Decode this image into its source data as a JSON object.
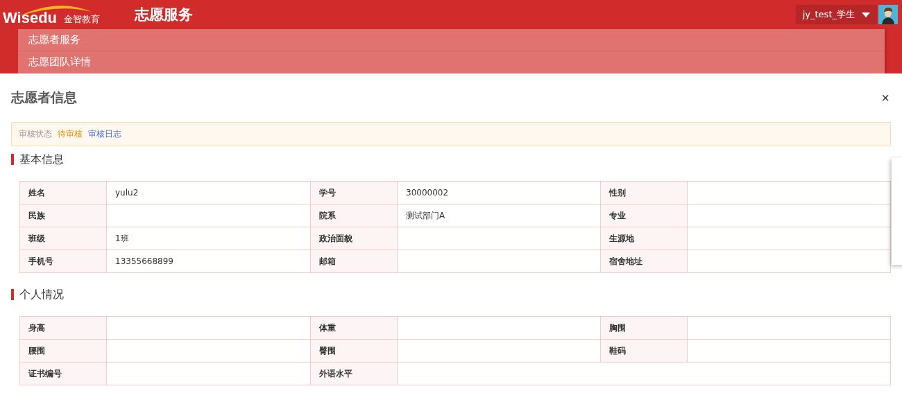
{
  "header": {
    "logo_text": "Wisedu",
    "logo_subtext": "金智教育",
    "app_title": "志愿服务",
    "user": "jy_test_学生"
  },
  "menu": [
    {
      "label": "志愿者服务"
    },
    {
      "label": "志愿团队详情"
    }
  ],
  "dialog": {
    "title": "志愿者信息",
    "close": "×",
    "status": {
      "label": "审核状态",
      "value": "待审核",
      "log_link": "审核日志"
    },
    "sections": [
      {
        "title": "基本信息",
        "rows": [
          [
            {
              "label": "姓名",
              "value": "yulu2"
            },
            {
              "label": "学号",
              "value": "30000002"
            },
            {
              "label": "性别"
            }
          ],
          [
            {
              "label": "民族"
            },
            {
              "label": "院系",
              "value": "测试部门A"
            },
            {
              "label": "专业"
            }
          ],
          [
            {
              "label": "班级",
              "value": "1班"
            },
            {
              "label": "政治面貌"
            },
            {
              "label": "生源地"
            }
          ],
          [
            {
              "label": "手机号",
              "value": "13355668899"
            },
            {
              "label": "邮箱"
            },
            {
              "label": "宿舍地址"
            }
          ]
        ]
      },
      {
        "title": "个人情况",
        "rows": [
          [
            {
              "label": "身高"
            },
            {
              "label": "体重"
            },
            {
              "label": "胸围"
            }
          ],
          [
            {
              "label": "腰围"
            },
            {
              "label": "臀围"
            },
            {
              "label": "鞋码"
            }
          ],
          [
            {
              "label": "证书编号"
            },
            {
              "label": "外语水平"
            }
          ]
        ]
      }
    ]
  }
}
